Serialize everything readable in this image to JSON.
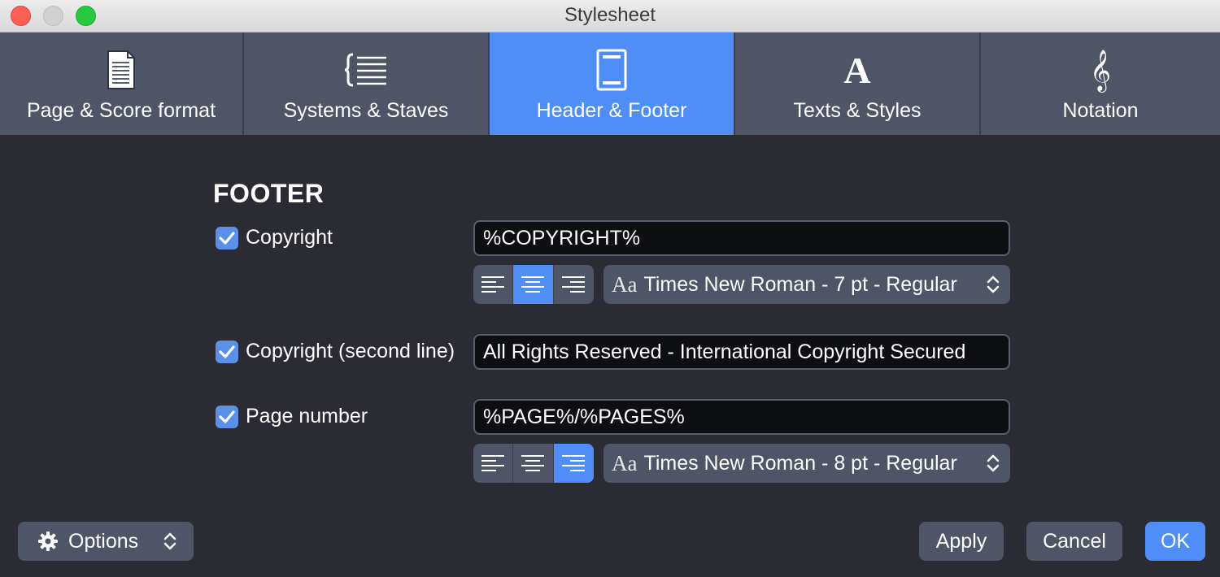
{
  "window": {
    "title": "Stylesheet"
  },
  "tabs": [
    {
      "label": "Page & Score format",
      "icon": "page-format-icon",
      "active": false
    },
    {
      "label": "Systems & Staves",
      "icon": "systems-staves-icon",
      "active": false
    },
    {
      "label": "Header & Footer",
      "icon": "header-footer-icon",
      "active": true
    },
    {
      "label": "Texts & Styles",
      "icon": "texts-styles-icon",
      "active": false
    },
    {
      "label": "Notation",
      "icon": "treble-clef-icon",
      "active": false
    }
  ],
  "footer": {
    "title": "FOOTER",
    "copyright": {
      "label": "Copyright",
      "checked": true,
      "value": "%COPYRIGHT%",
      "alignment": "center",
      "font": "Times New Roman - 7 pt - Regular"
    },
    "copyright_second": {
      "label": "Copyright (second line)",
      "checked": true,
      "value": "All Rights Reserved - International Copyright Secured"
    },
    "page_number": {
      "label": "Page number",
      "checked": true,
      "value": "%PAGE%/%PAGES%",
      "alignment": "right",
      "font": "Times New Roman - 8 pt - Regular"
    },
    "font_prefix": "Aa"
  },
  "buttons": {
    "options": "Options",
    "apply": "Apply",
    "cancel": "Cancel",
    "ok": "OK"
  },
  "colors": {
    "accent": "#4f8ef7",
    "background": "#2a2b33",
    "tab_bg": "#4f5466"
  }
}
